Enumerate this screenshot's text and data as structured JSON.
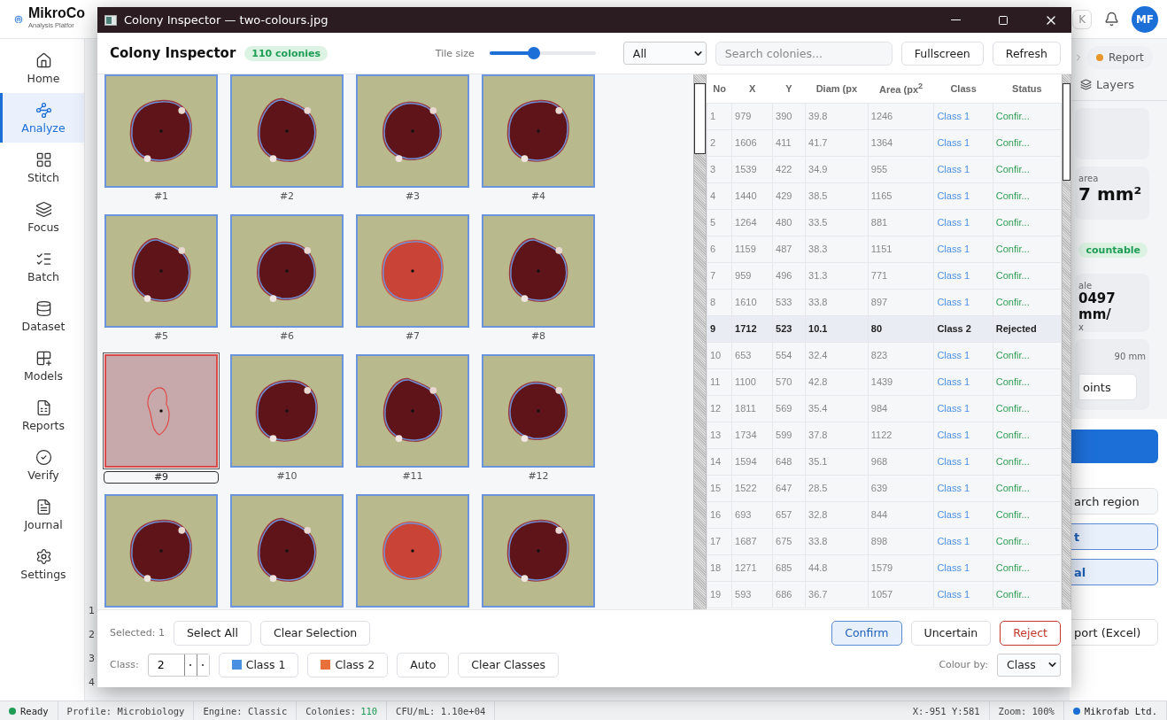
{
  "app": {
    "brand": "MikroCo",
    "subtitle": "Analysis Platfor",
    "shortcut": "K",
    "avatar": "MF"
  },
  "sidebar": {
    "items": [
      {
        "label": "Home",
        "selected": false
      },
      {
        "label": "Analyze",
        "selected": true
      },
      {
        "label": "Stitch",
        "selected": false
      },
      {
        "label": "Focus",
        "selected": false
      },
      {
        "label": "Batch",
        "selected": false
      },
      {
        "label": "Dataset",
        "selected": false
      },
      {
        "label": "Models",
        "selected": false
      },
      {
        "label": "Reports",
        "selected": false
      },
      {
        "label": "Verify",
        "selected": false
      },
      {
        "label": "Journal",
        "selected": false
      },
      {
        "label": "Settings",
        "selected": false
      }
    ]
  },
  "background_rows": [
    "1",
    "2",
    "3",
    "4"
  ],
  "right_panel": {
    "tabs": [
      {
        "label": "Report",
        "color": "#e8962a"
      },
      {
        "label": "Layers"
      }
    ],
    "area_label": "area",
    "area_value": "7 mm²",
    "badge": "countable",
    "scale_label": "ale",
    "scale_value": "0497 mm/",
    "scale_unit": "x",
    "dish": "90 mm",
    "points_button": "oints",
    "search_button": "arch region",
    "outline_buttons": [
      "t",
      "al"
    ],
    "export_button": "port (Excel)"
  },
  "dialog": {
    "title": "Colony Inspector — two-colours.jpg",
    "heading": "Colony Inspector",
    "count_badge": "110 colonies",
    "tile_size": {
      "label": "Tile size",
      "level": 0.42
    },
    "filter": {
      "value": "All"
    },
    "search": {
      "placeholder": "Search colonies..."
    },
    "buttons": [
      "Fullscreen",
      "Refresh"
    ],
    "tiles": [
      {
        "label": "#1",
        "kind": "dark",
        "selected": false
      },
      {
        "label": "#2",
        "kind": "dark",
        "selected": false
      },
      {
        "label": "#3",
        "kind": "dark",
        "selected": false
      },
      {
        "label": "#4",
        "kind": "dark",
        "selected": false
      },
      {
        "label": "#5",
        "kind": "dark",
        "selected": false
      },
      {
        "label": "#6",
        "kind": "dark",
        "selected": false
      },
      {
        "label": "#7",
        "kind": "light",
        "selected": false
      },
      {
        "label": "#8",
        "kind": "dark",
        "selected": false
      },
      {
        "label": "#9",
        "kind": "rejected",
        "selected": true
      },
      {
        "label": "#10",
        "kind": "dark",
        "selected": false
      },
      {
        "label": "#11",
        "kind": "dark",
        "selected": false
      },
      {
        "label": "#12",
        "kind": "dark",
        "selected": false
      },
      {
        "kind": "dark",
        "selected": false
      },
      {
        "kind": "dark",
        "selected": false
      },
      {
        "kind": "light",
        "selected": false
      },
      {
        "kind": "dark",
        "selected": false
      }
    ],
    "table": {
      "columns": [
        "No",
        "X",
        "Y",
        "Diam (px",
        "Area (px$^{2}$",
        "Class",
        "Status"
      ],
      "rows": [
        {
          "cells": [
            "1",
            "979",
            "390",
            "39.8",
            "1246",
            "Class 1",
            "Confir..."
          ],
          "selected": false
        },
        {
          "cells": [
            "2",
            "1606",
            "411",
            "41.7",
            "1364",
            "Class 1",
            "Confir..."
          ],
          "selected": false
        },
        {
          "cells": [
            "3",
            "1539",
            "422",
            "34.9",
            "955",
            "Class 1",
            "Confir..."
          ],
          "selected": false
        },
        {
          "cells": [
            "4",
            "1440",
            "429",
            "38.5",
            "1165",
            "Class 1",
            "Confir..."
          ],
          "selected": false
        },
        {
          "cells": [
            "5",
            "1264",
            "480",
            "33.5",
            "881",
            "Class 1",
            "Confir..."
          ],
          "selected": false
        },
        {
          "cells": [
            "6",
            "1159",
            "487",
            "38.3",
            "1151",
            "Class 1",
            "Confir..."
          ],
          "selected": false
        },
        {
          "cells": [
            "7",
            "959",
            "496",
            "31.3",
            "771",
            "Class 1",
            "Confir..."
          ],
          "selected": false
        },
        {
          "cells": [
            "8",
            "1610",
            "533",
            "33.8",
            "897",
            "Class 1",
            "Confir..."
          ],
          "selected": false
        },
        {
          "cells": [
            "9",
            "1712",
            "523",
            "10.1",
            "80",
            "Class 2",
            "Rejected"
          ],
          "selected": true
        },
        {
          "cells": [
            "10",
            "653",
            "554",
            "32.4",
            "823",
            "Class 1",
            "Confir..."
          ],
          "selected": false
        },
        {
          "cells": [
            "11",
            "1100",
            "570",
            "42.8",
            "1439",
            "Class 1",
            "Confir..."
          ],
          "selected": false
        },
        {
          "cells": [
            "12",
            "1811",
            "569",
            "35.4",
            "984",
            "Class 1",
            "Confir..."
          ],
          "selected": false
        },
        {
          "cells": [
            "13",
            "1734",
            "599",
            "37.8",
            "1122",
            "Class 1",
            "Confir..."
          ],
          "selected": false
        },
        {
          "cells": [
            "14",
            "1594",
            "648",
            "35.1",
            "968",
            "Class 1",
            "Confir..."
          ],
          "selected": false
        },
        {
          "cells": [
            "15",
            "1522",
            "647",
            "28.5",
            "639",
            "Class 1",
            "Confir..."
          ],
          "selected": false
        },
        {
          "cells": [
            "16",
            "693",
            "657",
            "32.8",
            "844",
            "Class 1",
            "Confir..."
          ],
          "selected": false
        },
        {
          "cells": [
            "17",
            "1687",
            "675",
            "33.8",
            "898",
            "Class 1",
            "Confir..."
          ],
          "selected": false
        },
        {
          "cells": [
            "18",
            "1271",
            "685",
            "44.8",
            "1579",
            "Class 1",
            "Confir..."
          ],
          "selected": false
        },
        {
          "cells": [
            "19",
            "593",
            "686",
            "36.7",
            "1057",
            "Class 1",
            "Confir..."
          ],
          "selected": false
        }
      ]
    },
    "footer": {
      "selected_label": "Selected: 1",
      "selection_buttons": [
        "Select All",
        "Clear Selection"
      ],
      "status_buttons": [
        {
          "label": "Confirm",
          "kind": "primary"
        },
        {
          "label": "Uncertain",
          "kind": "plain"
        },
        {
          "label": "Reject",
          "kind": "danger"
        }
      ],
      "class_label": "Class:",
      "class_value": "2",
      "class_buttons": [
        {
          "label": "Class 1",
          "color": "#4a90e2"
        },
        {
          "label": "Class 2",
          "color": "#e8703a"
        }
      ],
      "other_buttons": [
        "Auto",
        "Clear Classes"
      ],
      "colour_by_label": "Colour by:",
      "colour_by_value": "Class"
    }
  },
  "status_bar": [
    {
      "kind": "state",
      "text": "Ready",
      "color": "#1f9d55"
    },
    {
      "kind": "pair",
      "label": "Profile:",
      "value": "Microbiology"
    },
    {
      "kind": "pair",
      "label": "Engine:",
      "value": "Classic"
    },
    {
      "kind": "count",
      "label": "Colonies:",
      "value": "110"
    },
    {
      "kind": "pair",
      "label": "CFU/mL:",
      "value": "1.10e+04"
    },
    {
      "kind": "spacer"
    },
    {
      "kind": "plain",
      "text": "X:-951 Y:581"
    },
    {
      "kind": "plain",
      "text": "Zoom: 100%"
    },
    {
      "kind": "state",
      "text": "Mikrofab Ltd.",
      "color": "#1d6fd8"
    }
  ]
}
